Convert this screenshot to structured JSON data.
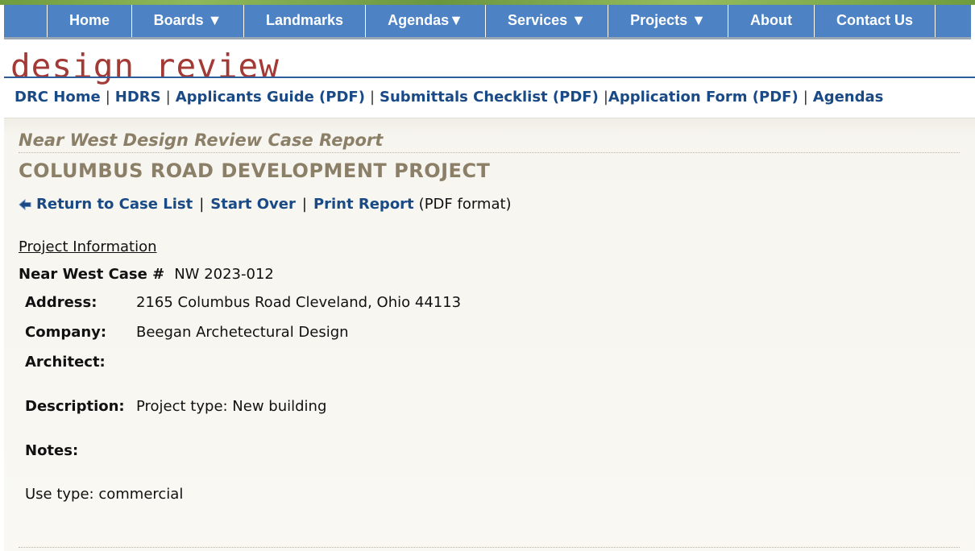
{
  "nav": {
    "items": [
      {
        "label": "Home"
      },
      {
        "label": "Boards ▼"
      },
      {
        "label": "Landmarks"
      },
      {
        "label": "Agendas▼"
      },
      {
        "label": "Services ▼"
      },
      {
        "label": "Projects ▼"
      },
      {
        "label": "About"
      },
      {
        "label": "Contact Us"
      }
    ]
  },
  "logo": {
    "text": "design review"
  },
  "sublinks": {
    "drc_home": "DRC Home",
    "hdrs": "HDRS",
    "applicants_guide": "Applicants Guide (PDF)",
    "submittals_checklist": "Submittals Checklist (PDF)",
    "application_form": "Application Form (PDF)",
    "agendas": "Agendas",
    "separator": "|"
  },
  "report": {
    "subtitle": "Near West Design Review Case Report",
    "title": "COLUMBUS ROAD DEVELOPMENT PROJECT",
    "actions": {
      "return": "Return to Case List",
      "start_over": "Start Over",
      "print": "Print Report",
      "print_note": "(PDF format)"
    },
    "section_heading": "Project Information",
    "case_label": "Near West Case #",
    "case_number": "NW 2023-012",
    "fields": {
      "address_label": "Address:",
      "address_value": "2165 Columbus Road Cleveland, Ohio 44113",
      "company_label": "Company:",
      "company_value": "Beegan Archetectural Design",
      "architect_label": "Architect:",
      "architect_value": "",
      "description_label": "Description:",
      "description_value": "Project type: New building",
      "notes_label": "Notes:",
      "notes_value": ""
    },
    "use_type": "Use type: commercial"
  },
  "colors": {
    "nav_bg": "#4d82c4",
    "link": "#1a4a85",
    "logo": "#a33a36",
    "heading": "#8b7f68"
  }
}
